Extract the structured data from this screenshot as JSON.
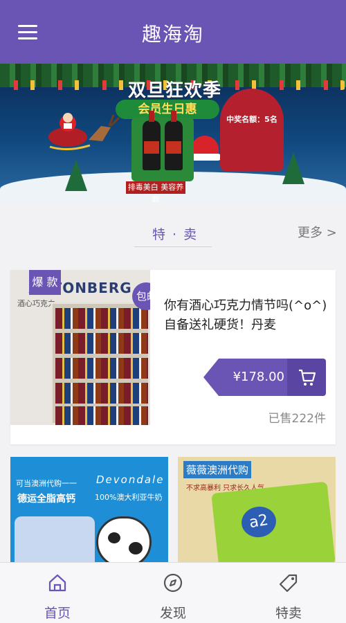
{
  "header": {
    "title": "趣海淘",
    "menu_icon": "hamburger-menu-icon"
  },
  "banner": {
    "title": "双旦狂欢季",
    "subtitle": "会员生日惠",
    "product_tag": "排毒美白 美容养颜",
    "prize_title": "中奖名额：5名"
  },
  "section": {
    "title": "特 · 卖",
    "more_label": "更多 >"
  },
  "featured": {
    "badge": "爆 款",
    "side_tag": "包邮",
    "image_brand": "ANTONBERG",
    "image_sub": "酒心巧克力",
    "name": "你有酒心巧克力情节吗(^o^)自备送礼硬货！丹麦",
    "price": "¥178.00",
    "sold": "已售222件",
    "cart_icon": "cart-icon"
  },
  "grid": [
    {
      "top_text": "可当澳洲代购一一",
      "brand": "Devondale",
      "line1": "德运全脂高钙",
      "line2": "100%澳大利亚牛奶"
    },
    {
      "brand": "薇薇澳洲代购",
      "line1": "不求高暴利 只求长久人气",
      "product": "a2"
    }
  ],
  "tabs": [
    {
      "label": "首页",
      "icon": "home-icon",
      "active": true
    },
    {
      "label": "发现",
      "icon": "compass-icon",
      "active": false
    },
    {
      "label": "特卖",
      "icon": "tag-icon",
      "active": false
    }
  ],
  "colors": {
    "brand": "#6a54b4",
    "background": "#f2f2f4"
  }
}
